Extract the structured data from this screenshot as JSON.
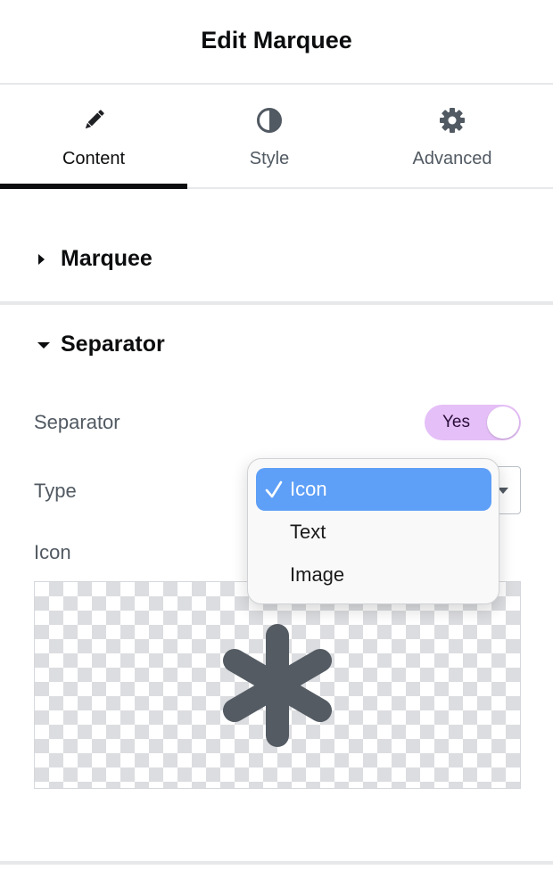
{
  "header": {
    "title": "Edit Marquee"
  },
  "tabs": [
    {
      "label": "Content",
      "icon": "pencil-icon",
      "active": true
    },
    {
      "label": "Style",
      "icon": "half-circle-icon",
      "active": false
    },
    {
      "label": "Advanced",
      "icon": "gear-icon",
      "active": false
    }
  ],
  "sections": {
    "marquee": {
      "title": "Marquee",
      "expanded": false
    },
    "separator": {
      "title": "Separator",
      "expanded": true,
      "controls": {
        "separator_label": "Separator",
        "separator_toggle_value": "Yes",
        "type_label": "Type",
        "icon_label": "Icon",
        "icon_preview": "asterisk-icon"
      }
    }
  },
  "dropdown": {
    "options": [
      "Icon",
      "Text",
      "Image"
    ],
    "selected": "Icon"
  },
  "colors": {
    "toggle_bg": "#e5bff7",
    "dropdown_highlight": "#5e9ff7",
    "icon_color": "#545b63",
    "active_tab_underline": "#0c0d0e"
  }
}
